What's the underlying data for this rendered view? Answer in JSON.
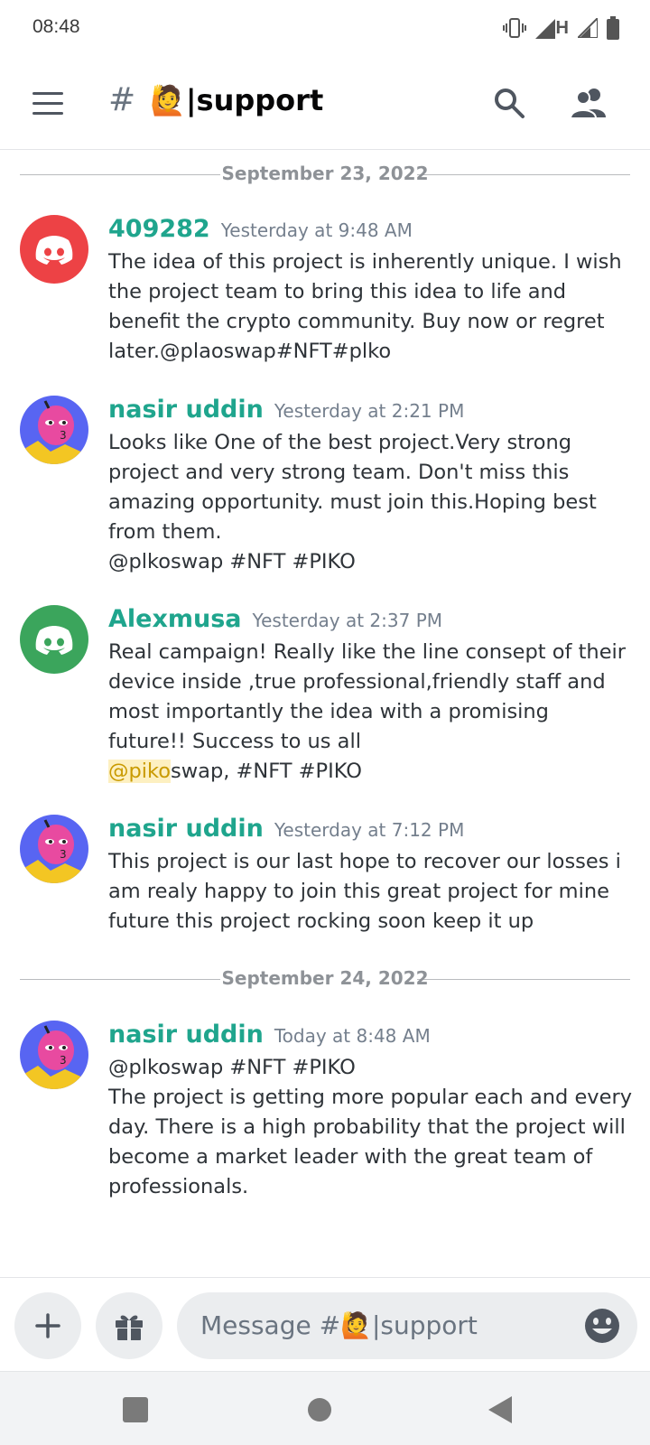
{
  "status_bar": {
    "time": "08:48",
    "network": "H"
  },
  "header": {
    "hash": "#",
    "channel_emoji": "🙋",
    "channel_sep": "|",
    "channel_name": "support"
  },
  "dates": {
    "first": "September 23, 2022",
    "second": "September 24, 2022"
  },
  "messages": [
    {
      "author": "409282",
      "time": "Yesterday at 9:48 AM",
      "lines": [
        "The idea of this project is inherently unique. I wish the project team to bring this idea to life and benefit the crypto community. Buy now or regret later.@plaoswap#NFT#plko"
      ]
    },
    {
      "author": "nasir uddin",
      "time": "Yesterday at 2:21 PM",
      "lines": [
        "Looks like One of the best project.Very strong project and very strong team. Don't miss this amazing opportunity. must join this.Hoping best from them.",
        "@plkoswap #NFT #PIKO"
      ]
    },
    {
      "author": "Alexmusa",
      "time": "Yesterday at 2:37 PM",
      "lines": [
        "Real campaign! Really like the line consept of their device inside ,true professional,friendly staff and most importantly the idea with a promising future!! Success to us all"
      ],
      "mention": "@piko",
      "mention_tail": "swap, #NFT #PIKO"
    },
    {
      "author": "nasir uddin",
      "time": "Yesterday at 7:12 PM",
      "lines": [
        "This project is our last hope to recover our losses i am realy happy to join this great project for mine future this project rocking soon keep it up"
      ]
    },
    {
      "author": "nasir uddin",
      "time": "Today at 8:48 AM",
      "lines": [
        "@plkoswap #NFT #PIKO",
        "The project is getting more popular each and every day. There is a high probability that the project will become a market leader with the great team of professionals."
      ]
    }
  ],
  "composer": {
    "placeholder_prefix": "Message #",
    "placeholder_emoji": "🙋",
    "placeholder_sep": "|",
    "placeholder_channel": "support"
  },
  "colors": {
    "author": "#1fa58d",
    "discord_red": "#ed4245",
    "discord_green": "#3ba55c",
    "avatar_bg": "#5865f2",
    "mention_bg": "#fdf0c1"
  },
  "icons": {
    "menu": "hamburger-menu-icon",
    "search": "search-icon",
    "members": "members-icon",
    "add": "plus-icon",
    "gift": "gift-icon",
    "emoji": "emoji-icon"
  }
}
